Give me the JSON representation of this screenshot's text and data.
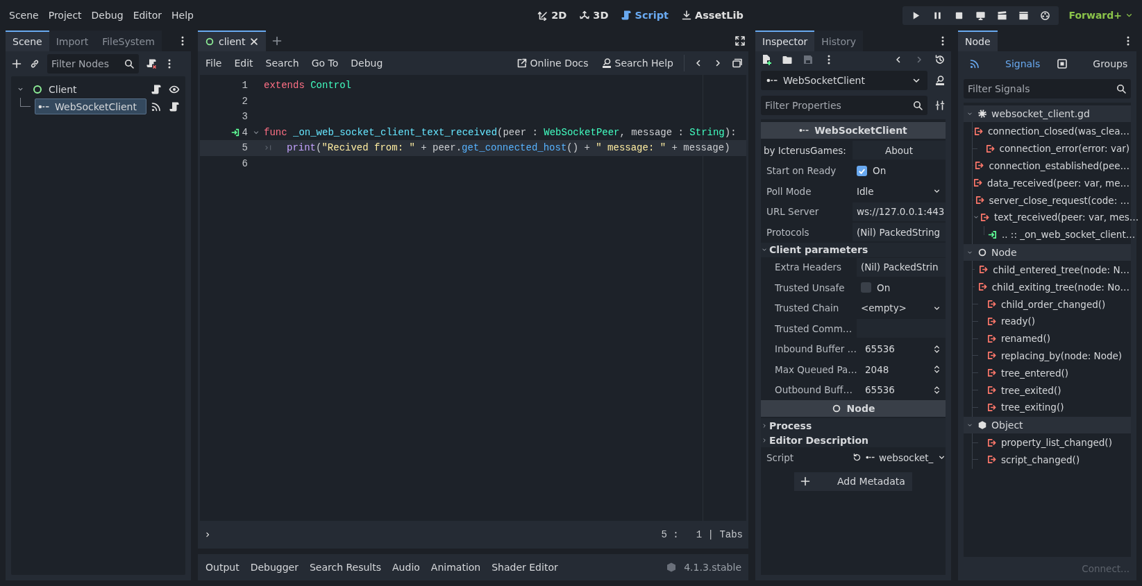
{
  "menu": [
    "Scene",
    "Project",
    "Debug",
    "Editor",
    "Help"
  ],
  "workspaces": [
    {
      "label": "2D",
      "kind": "plane",
      "selected": false
    },
    {
      "label": "3D",
      "kind": "space",
      "selected": false
    },
    {
      "label": "Script",
      "kind": "script",
      "selected": true
    },
    {
      "label": "AssetLib",
      "kind": "assetlib",
      "selected": false
    }
  ],
  "renderer": "Forward+",
  "scene_dock": {
    "tabs": [
      {
        "label": "Scene",
        "selected": true
      },
      {
        "label": "Import",
        "selected": false
      },
      {
        "label": "FileSystem",
        "selected": false
      }
    ],
    "filter": {
      "placeholder": "Filter Nodes"
    },
    "tree": [
      {
        "name": "Client",
        "kind": "control",
        "expanded": true,
        "selected": false,
        "badges": [
          {
            "kind": "script"
          },
          {
            "kind": "eye"
          }
        ],
        "children": [
          {
            "name": "WebSocketClient",
            "kind": "websocket",
            "selected": true,
            "badges": [
              {
                "kind": "signals"
              },
              {
                "kind": "script"
              }
            ]
          }
        ]
      }
    ]
  },
  "script_editor": {
    "tabs": [
      {
        "label": "client",
        "selected": true
      }
    ],
    "menu": [
      "File",
      "Edit",
      "Search",
      "Go To",
      "Debug"
    ],
    "links": [
      {
        "label": "Online Docs",
        "kind": "docs"
      },
      {
        "label": "Search Help",
        "kind": "help"
      }
    ],
    "lines": [
      {
        "number": "1",
        "current": false,
        "connected": false,
        "foldable": false,
        "indented": false,
        "tokens": [
          {
            "text": "extends",
            "kind": "keyword"
          },
          {
            "text": " Control",
            "kind": "type"
          }
        ]
      },
      {
        "number": "2",
        "current": false,
        "connected": false,
        "foldable": false,
        "indented": false
      },
      {
        "number": "3",
        "current": false,
        "connected": false,
        "foldable": false,
        "indented": false
      },
      {
        "number": "4",
        "current": false,
        "connected": true,
        "foldable": true,
        "indented": false,
        "tokens": [
          {
            "text": "func",
            "kind": "keyword"
          },
          {
            "text": " _on_web_socket_client_text_received",
            "kind": "function"
          },
          {
            "text": "(peer : ",
            "kind": "plain"
          },
          {
            "text": "WebSocketPeer",
            "kind": "type"
          },
          {
            "text": ", message : ",
            "kind": "plain"
          },
          {
            "text": "String",
            "kind": "type"
          },
          {
            "text": "):",
            "kind": "plain"
          }
        ]
      },
      {
        "number": "5",
        "current": true,
        "connected": false,
        "foldable": false,
        "indented": true,
        "tokens": [
          {
            "text": "print",
            "kind": "builtin"
          },
          {
            "text": "(",
            "kind": "plain"
          },
          {
            "text": "\"Recived from: \"",
            "kind": "string"
          },
          {
            "text": " + peer.",
            "kind": "plain"
          },
          {
            "text": "get_connected_host",
            "kind": "member"
          },
          {
            "text": "() + ",
            "kind": "plain"
          },
          {
            "text": "\" message: \"",
            "kind": "string"
          },
          {
            "text": " + message)",
            "kind": "plain"
          }
        ]
      },
      {
        "number": "6",
        "current": false,
        "connected": false,
        "foldable": false,
        "indented": false
      }
    ],
    "position": "5 :   1 | Tabs"
  },
  "bottom_panel": {
    "tabs": [
      "Output",
      "Debugger",
      "Search Results",
      "Audio",
      "Animation",
      "Shader Editor"
    ],
    "version": "4.1.3.stable"
  },
  "inspector": {
    "tabs": [
      {
        "label": "Inspector",
        "selected": true
      },
      {
        "label": "History",
        "selected": false
      }
    ],
    "object": "WebSocketClient",
    "filter": {
      "placeholder": "Filter Properties"
    },
    "properties": [
      {
        "kind": "header",
        "label": "WebSocketClient"
      },
      {
        "kind": "about",
        "label": "by IcterusGames:",
        "button": "About"
      },
      {
        "kind": "check",
        "label": "Start on Ready",
        "checked": true,
        "text": "On"
      },
      {
        "kind": "enum",
        "label": "Poll Mode",
        "value": "Idle"
      },
      {
        "kind": "text",
        "label": "URL Server",
        "value": "ws://127.0.0.1:443"
      },
      {
        "kind": "text",
        "label": "Protocols",
        "value": "(Nil) PackedString"
      },
      {
        "kind": "group",
        "label": "Client parameters",
        "expanded": true,
        "children": [
          {
            "kind": "text",
            "label": "Extra Headers",
            "value": "(Nil) PackedStrin"
          },
          {
            "kind": "check",
            "label": "Trusted Unsafe",
            "checked": false,
            "text": "On"
          },
          {
            "kind": "enum",
            "label": "Trusted Chain",
            "value": "<empty>"
          },
          {
            "kind": "text",
            "label": "Trusted Comm…"
          },
          {
            "kind": "spin",
            "label": "Inbound Buffer …",
            "value": "65536"
          },
          {
            "kind": "spin",
            "label": "Max Queued Pa…",
            "value": "2048"
          },
          {
            "kind": "spin",
            "label": "Outbound Buff…",
            "value": "65536"
          }
        ]
      },
      {
        "kind": "header",
        "label": "Node"
      },
      {
        "kind": "group",
        "label": "Process",
        "expanded": false
      },
      {
        "kind": "group",
        "label": "Editor Description",
        "expanded": false
      },
      {
        "kind": "script",
        "label": "Script",
        "value": "websocket_"
      }
    ],
    "add_metadata": "Add Metadata"
  },
  "node_dock": {
    "tab": "Node",
    "modes": [
      {
        "label": "Signals",
        "kind": "signals",
        "selected": true
      },
      {
        "label": "Groups",
        "kind": "groups",
        "selected": false
      }
    ],
    "filter": {
      "placeholder": "Filter Signals"
    },
    "classes": [
      {
        "name": "websocket_client.gd",
        "kind": "script",
        "expanded": true,
        "signals": [
          {
            "name": "connection_closed(was_clea…",
            "expanded": false
          },
          {
            "name": "connection_error(error: var)",
            "expanded": false
          },
          {
            "name": "connection_established(pee…",
            "expanded": false
          },
          {
            "name": "data_received(peer: var, me…",
            "expanded": false
          },
          {
            "name": "server_close_request(code: …",
            "expanded": false
          },
          {
            "name": "text_received(peer: var, mes…",
            "expanded": true,
            "connections": [
              ".. :: _on_web_socket_client…"
            ]
          }
        ]
      },
      {
        "name": "Node",
        "kind": "node",
        "expanded": true,
        "signals": [
          {
            "name": "child_entered_tree(node: N…",
            "expanded": false
          },
          {
            "name": "child_exiting_tree(node: No…",
            "expanded": false
          },
          {
            "name": "child_order_changed()",
            "expanded": false
          },
          {
            "name": "ready()",
            "expanded": false
          },
          {
            "name": "renamed()",
            "expanded": false
          },
          {
            "name": "replacing_by(node: Node)",
            "expanded": false
          },
          {
            "name": "tree_entered()",
            "expanded": false
          },
          {
            "name": "tree_exited()",
            "expanded": false
          },
          {
            "name": "tree_exiting()",
            "expanded": false
          }
        ]
      },
      {
        "name": "Object",
        "kind": "object",
        "expanded": true,
        "signals": [
          {
            "name": "property_list_changed()",
            "expanded": false
          },
          {
            "name": "script_changed()",
            "expanded": false
          }
        ]
      }
    ],
    "connect_button": {
      "label": "Connect...",
      "disabled": true
    }
  }
}
